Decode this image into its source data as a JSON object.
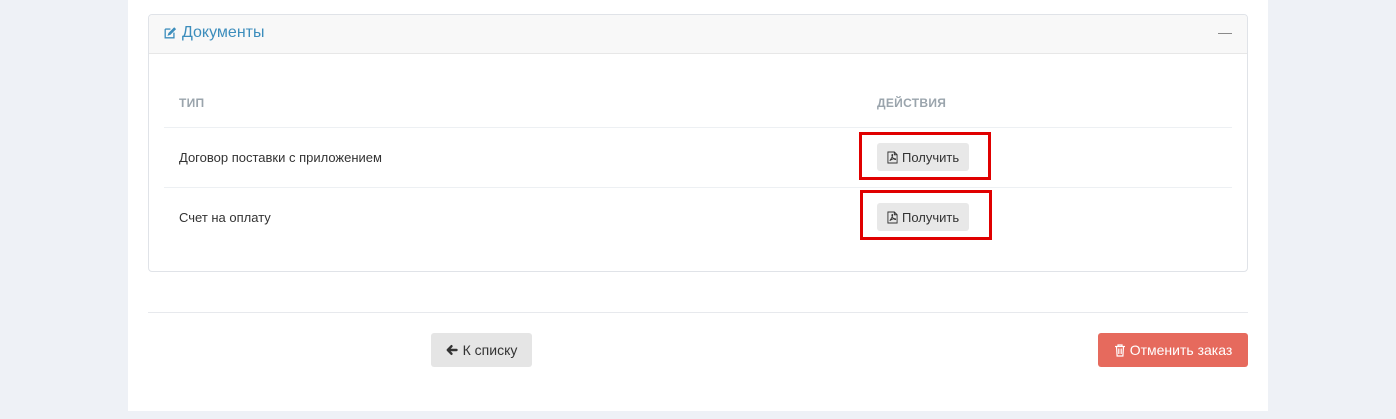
{
  "documents_panel": {
    "title": "Документы",
    "title_icon": "edit-icon",
    "collapse_icon": "minus-icon",
    "table": {
      "columns": [
        "ТИП",
        "ДЕЙСТВИЯ"
      ],
      "rows": [
        {
          "type": "Договор поставки с приложением",
          "action_label": "Получить",
          "action_icon": "pdf-icon"
        },
        {
          "type": "Счет на оплату",
          "action_label": "Получить",
          "action_icon": "pdf-icon"
        }
      ]
    }
  },
  "footer": {
    "back_label": "К списку",
    "back_icon": "arrow-left-icon",
    "cancel_label": "Отменить заказ",
    "cancel_icon": "trash-icon"
  },
  "colors": {
    "page_bg": "#eef1f6",
    "accent": "#3c8dbc",
    "danger": "#e66a5d",
    "highlight": "#e00000"
  }
}
